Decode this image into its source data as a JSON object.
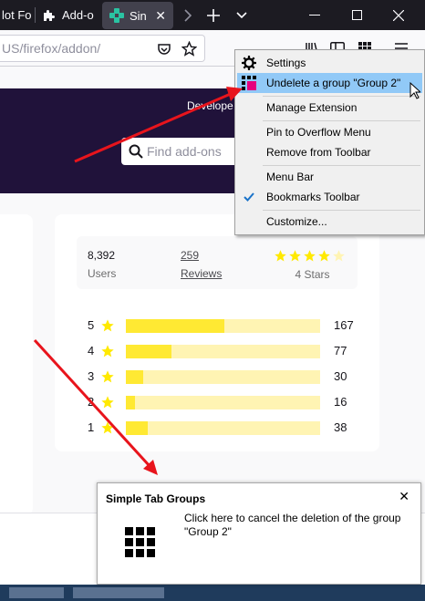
{
  "tabs": [
    {
      "label": "lot Fo"
    },
    {
      "label": "Add-o"
    },
    {
      "label": "Sin"
    }
  ],
  "address_bar": {
    "url": "US/firefox/addon/"
  },
  "header": {
    "dev_hub": "Develope",
    "search_placeholder": "Find add-ons"
  },
  "stats": {
    "users_count": "8,392",
    "users_label": "Users",
    "reviews_count": "259",
    "reviews_label": "Reviews",
    "stars_label": "4 Stars",
    "rating": 4
  },
  "rating_breakdown": [
    {
      "stars": "5",
      "count": "167",
      "fraction": 0.507
    },
    {
      "stars": "4",
      "count": "77",
      "fraction": 0.234
    },
    {
      "stars": "3",
      "count": "30",
      "fraction": 0.091
    },
    {
      "stars": "2",
      "count": "16",
      "fraction": 0.049
    },
    {
      "stars": "1",
      "count": "38",
      "fraction": 0.115
    }
  ],
  "context_menu": {
    "items": [
      {
        "label": "Settings"
      },
      {
        "label": "Undelete a group \"Group 2\""
      },
      {
        "label": "Manage Extension"
      },
      {
        "label": "Pin to Overflow Menu"
      },
      {
        "label": "Remove from Toolbar"
      },
      {
        "label": "Menu Bar"
      },
      {
        "label": "Bookmarks Toolbar"
      },
      {
        "label": "Customize..."
      }
    ]
  },
  "notification": {
    "title": "Simple Tab Groups",
    "body": "Click here to cancel the deletion of the group \"Group 2\""
  },
  "colors": {
    "highlight": "#91c9f7",
    "arrow": "#e8141c",
    "star_yellow": "#ffe900",
    "bar_fill": "#ffe933",
    "bar_track": "#fff4b3",
    "header_bg": "#20123a"
  }
}
